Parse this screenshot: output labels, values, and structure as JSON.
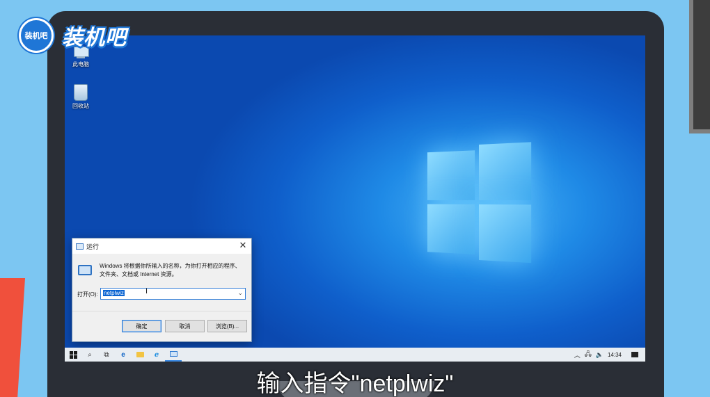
{
  "brand": {
    "logo_text": "装机吧",
    "name": "装机吧"
  },
  "desktop": {
    "icons": [
      {
        "label": "此电脑"
      },
      {
        "label": "回收站"
      }
    ]
  },
  "run_dialog": {
    "title": "运行",
    "close_glyph": "✕",
    "description": "Windows 将根据你所输入的名称，为你打开相应的程序、文件夹、文档或 Internet 资源。",
    "open_label": "打开(O):",
    "open_value": "netplwiz",
    "buttons": {
      "ok": "确定",
      "cancel": "取消",
      "browse": "浏览(B)..."
    }
  },
  "taskbar": {
    "tray_chevron": "︿",
    "time": "14:34"
  },
  "subtitle": "输入指令\"netplwiz\""
}
